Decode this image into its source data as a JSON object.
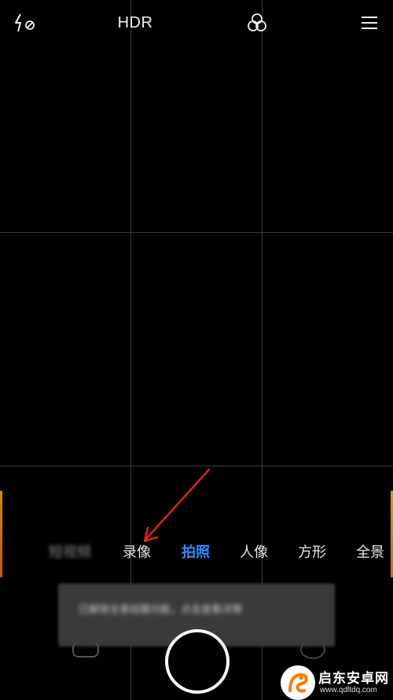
{
  "topbar": {
    "flash_icon": "flash-off-icon",
    "hdr_label": "HDR",
    "filters_icon": "filters-icon",
    "menu_icon": "menu-icon"
  },
  "modes": {
    "items": [
      {
        "label": "短视频",
        "state": "blurred"
      },
      {
        "label": "录像",
        "state": "normal"
      },
      {
        "label": "拍照",
        "state": "active"
      },
      {
        "label": "人像",
        "state": "normal"
      },
      {
        "label": "方形",
        "state": "normal"
      },
      {
        "label": "全景",
        "state": "partial"
      }
    ],
    "active_color": "#2b8cff"
  },
  "toast": {
    "text": "已解锁全景拍摄功能，点击查看详情"
  },
  "annotation": {
    "color": "#e02020",
    "points_to": "录像"
  },
  "watermark": {
    "title": "启东安卓网",
    "url": "www.qdltdq.com",
    "accent_color": "#ff7a00"
  }
}
